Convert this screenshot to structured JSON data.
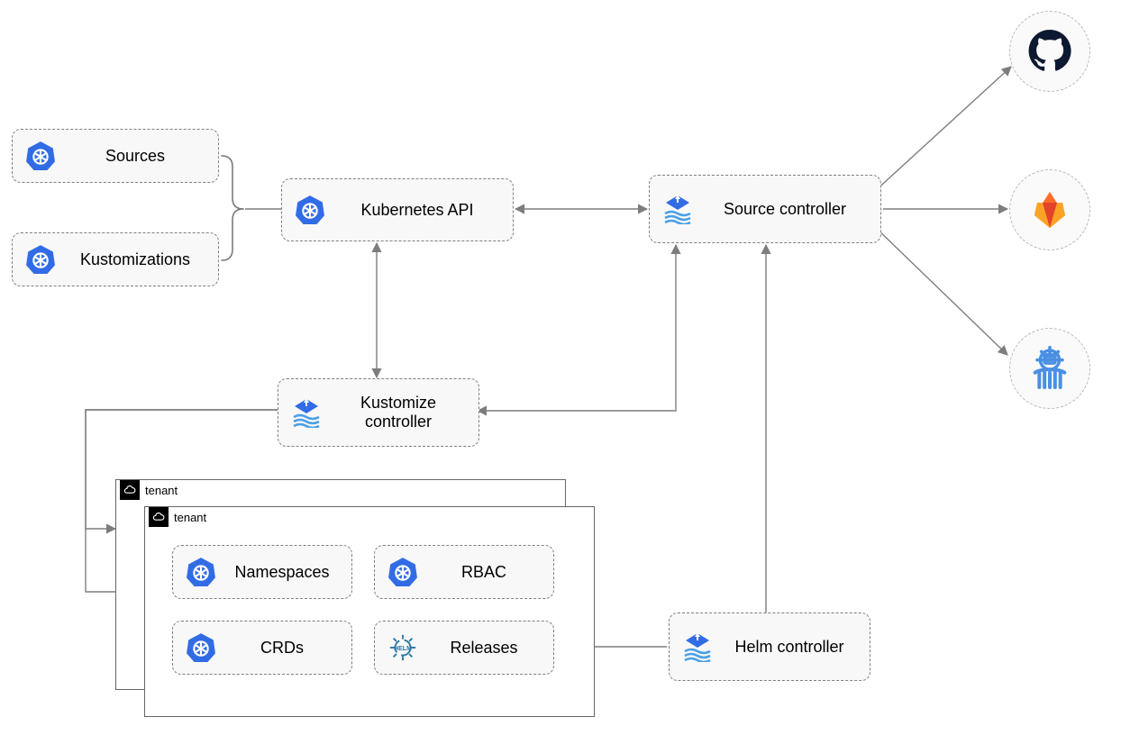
{
  "nodes": {
    "sources": {
      "label": "Sources"
    },
    "kustomizations": {
      "label": "Kustomizations"
    },
    "k8s_api": {
      "label": "Kubernetes API"
    },
    "source_ctrl": {
      "label": "Source controller"
    },
    "kustomize_ctrl": {
      "label": "Kustomize controller"
    },
    "helm_ctrl": {
      "label": "Helm controller"
    },
    "namespaces": {
      "label": "Namespaces"
    },
    "rbac": {
      "label": "RBAC"
    },
    "crds": {
      "label": "CRDs"
    },
    "releases": {
      "label": "Releases"
    },
    "tenant1": {
      "label": "tenant"
    },
    "tenant2": {
      "label": "tenant"
    }
  },
  "externals": {
    "github": {
      "name": "GitHub"
    },
    "gitlab": {
      "name": "GitLab"
    },
    "helmrepo": {
      "name": "Helm repository"
    }
  }
}
